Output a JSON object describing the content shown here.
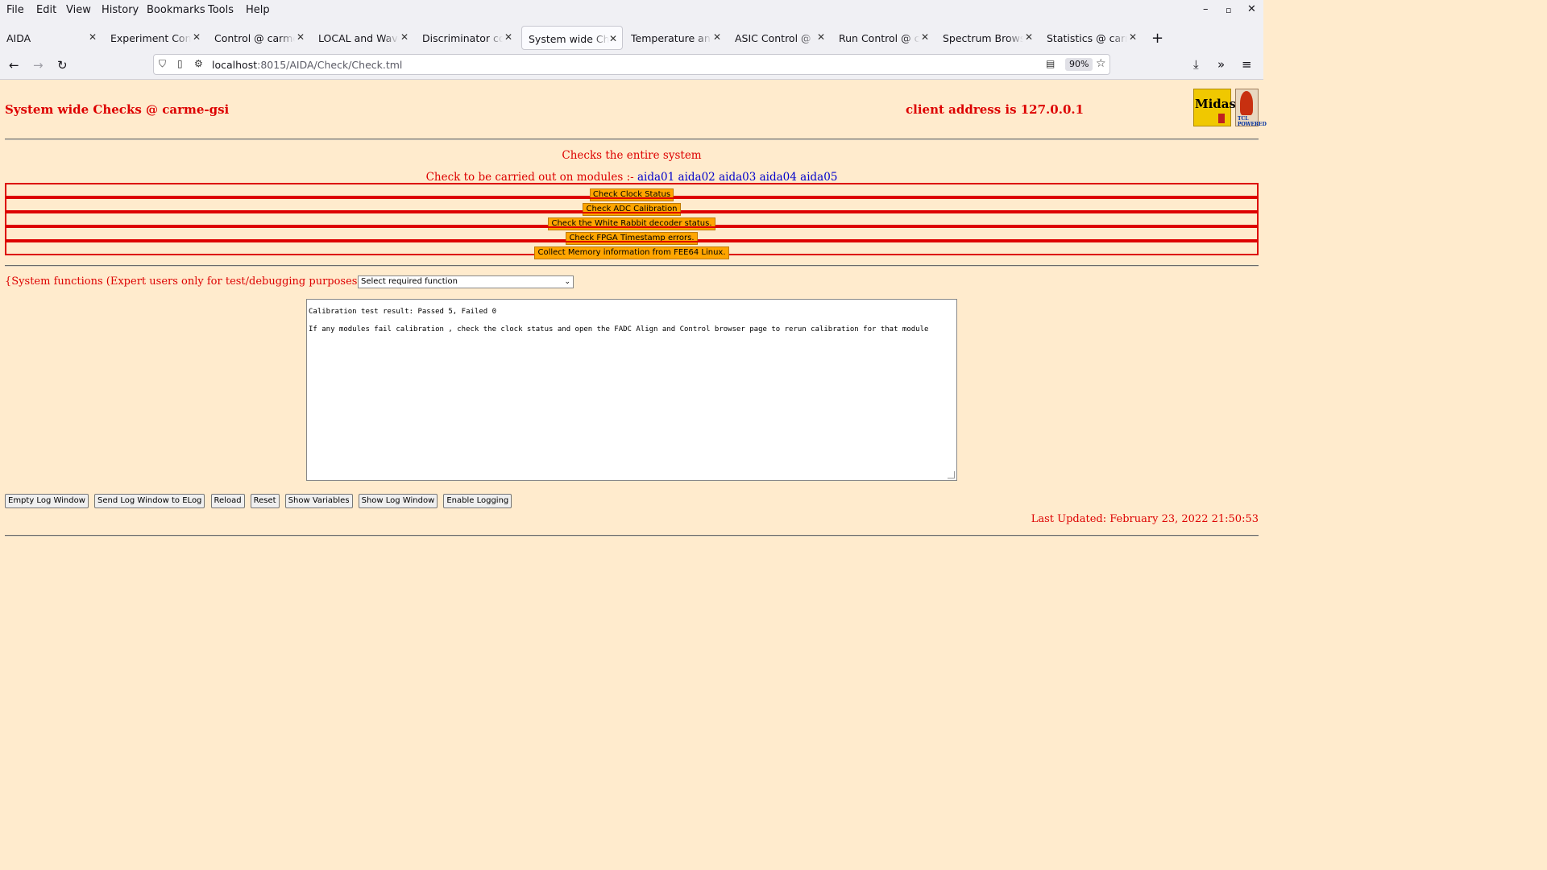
{
  "menu": [
    "File",
    "Edit",
    "View",
    "History",
    "Bookmarks",
    "Tools",
    "Help"
  ],
  "window_controls": {
    "minimize": "–",
    "maximize": "▫",
    "close": "✕"
  },
  "tabs": [
    {
      "label": "AIDA",
      "active": false
    },
    {
      "label": "Experiment Control",
      "active": false
    },
    {
      "label": "Control @ carme-gsi",
      "active": false
    },
    {
      "label": "LOCAL and Waveform",
      "active": false
    },
    {
      "label": "Discriminator control",
      "active": false
    },
    {
      "label": "System wide Checks",
      "active": true
    },
    {
      "label": "Temperature and status",
      "active": false
    },
    {
      "label": "ASIC Control @ carme",
      "active": false
    },
    {
      "label": "Run Control @ carme",
      "active": false
    },
    {
      "label": "Spectrum Browser",
      "active": false
    },
    {
      "label": "Statistics @ carme",
      "active": false
    }
  ],
  "address": {
    "host": "localhost",
    "path": ":8015/AIDA/Check/Check.tml",
    "zoom": "90%"
  },
  "page": {
    "title": "System wide Checks @ carme-gsi",
    "client": "client address is 127.0.0.1",
    "logos": {
      "midas": "Midas",
      "tcl": "TCL POWERED"
    },
    "description": "Checks the entire system",
    "modules_label": "Check to be carried out on modules :-",
    "modules": [
      "aida01",
      "aida02",
      "aida03",
      "aida04",
      "aida05"
    ],
    "checks": [
      "Check Clock Status",
      "Check ADC Calibration",
      "Check the White Rabbit decoder status.",
      "Check FPGA Timestamp errors.",
      "Collect Memory information from FEE64 Linux."
    ],
    "sysfunc_label": "{System functions (Expert users only for test/debugging purposes!!!)  } {",
    "select_value": "Select required function",
    "log_lines": [
      "Calibration test result: Passed 5, Failed 0",
      "If any modules fail calibration , check the clock status and open the FADC Align and Control browser page to rerun calibration for that module"
    ],
    "buttons": [
      "Empty Log Window",
      "Send Log Window to ELog",
      "Reload",
      "Reset",
      "Show Variables",
      "Show Log Window",
      "Enable Logging"
    ],
    "last_updated": "Last Updated: February 23, 2022 21:50:53"
  },
  "colors": {
    "page_bg": "#ffebcd",
    "text_red": "#dd0000",
    "module_blue": "#0000cc",
    "button_orange": "#ffa500"
  }
}
